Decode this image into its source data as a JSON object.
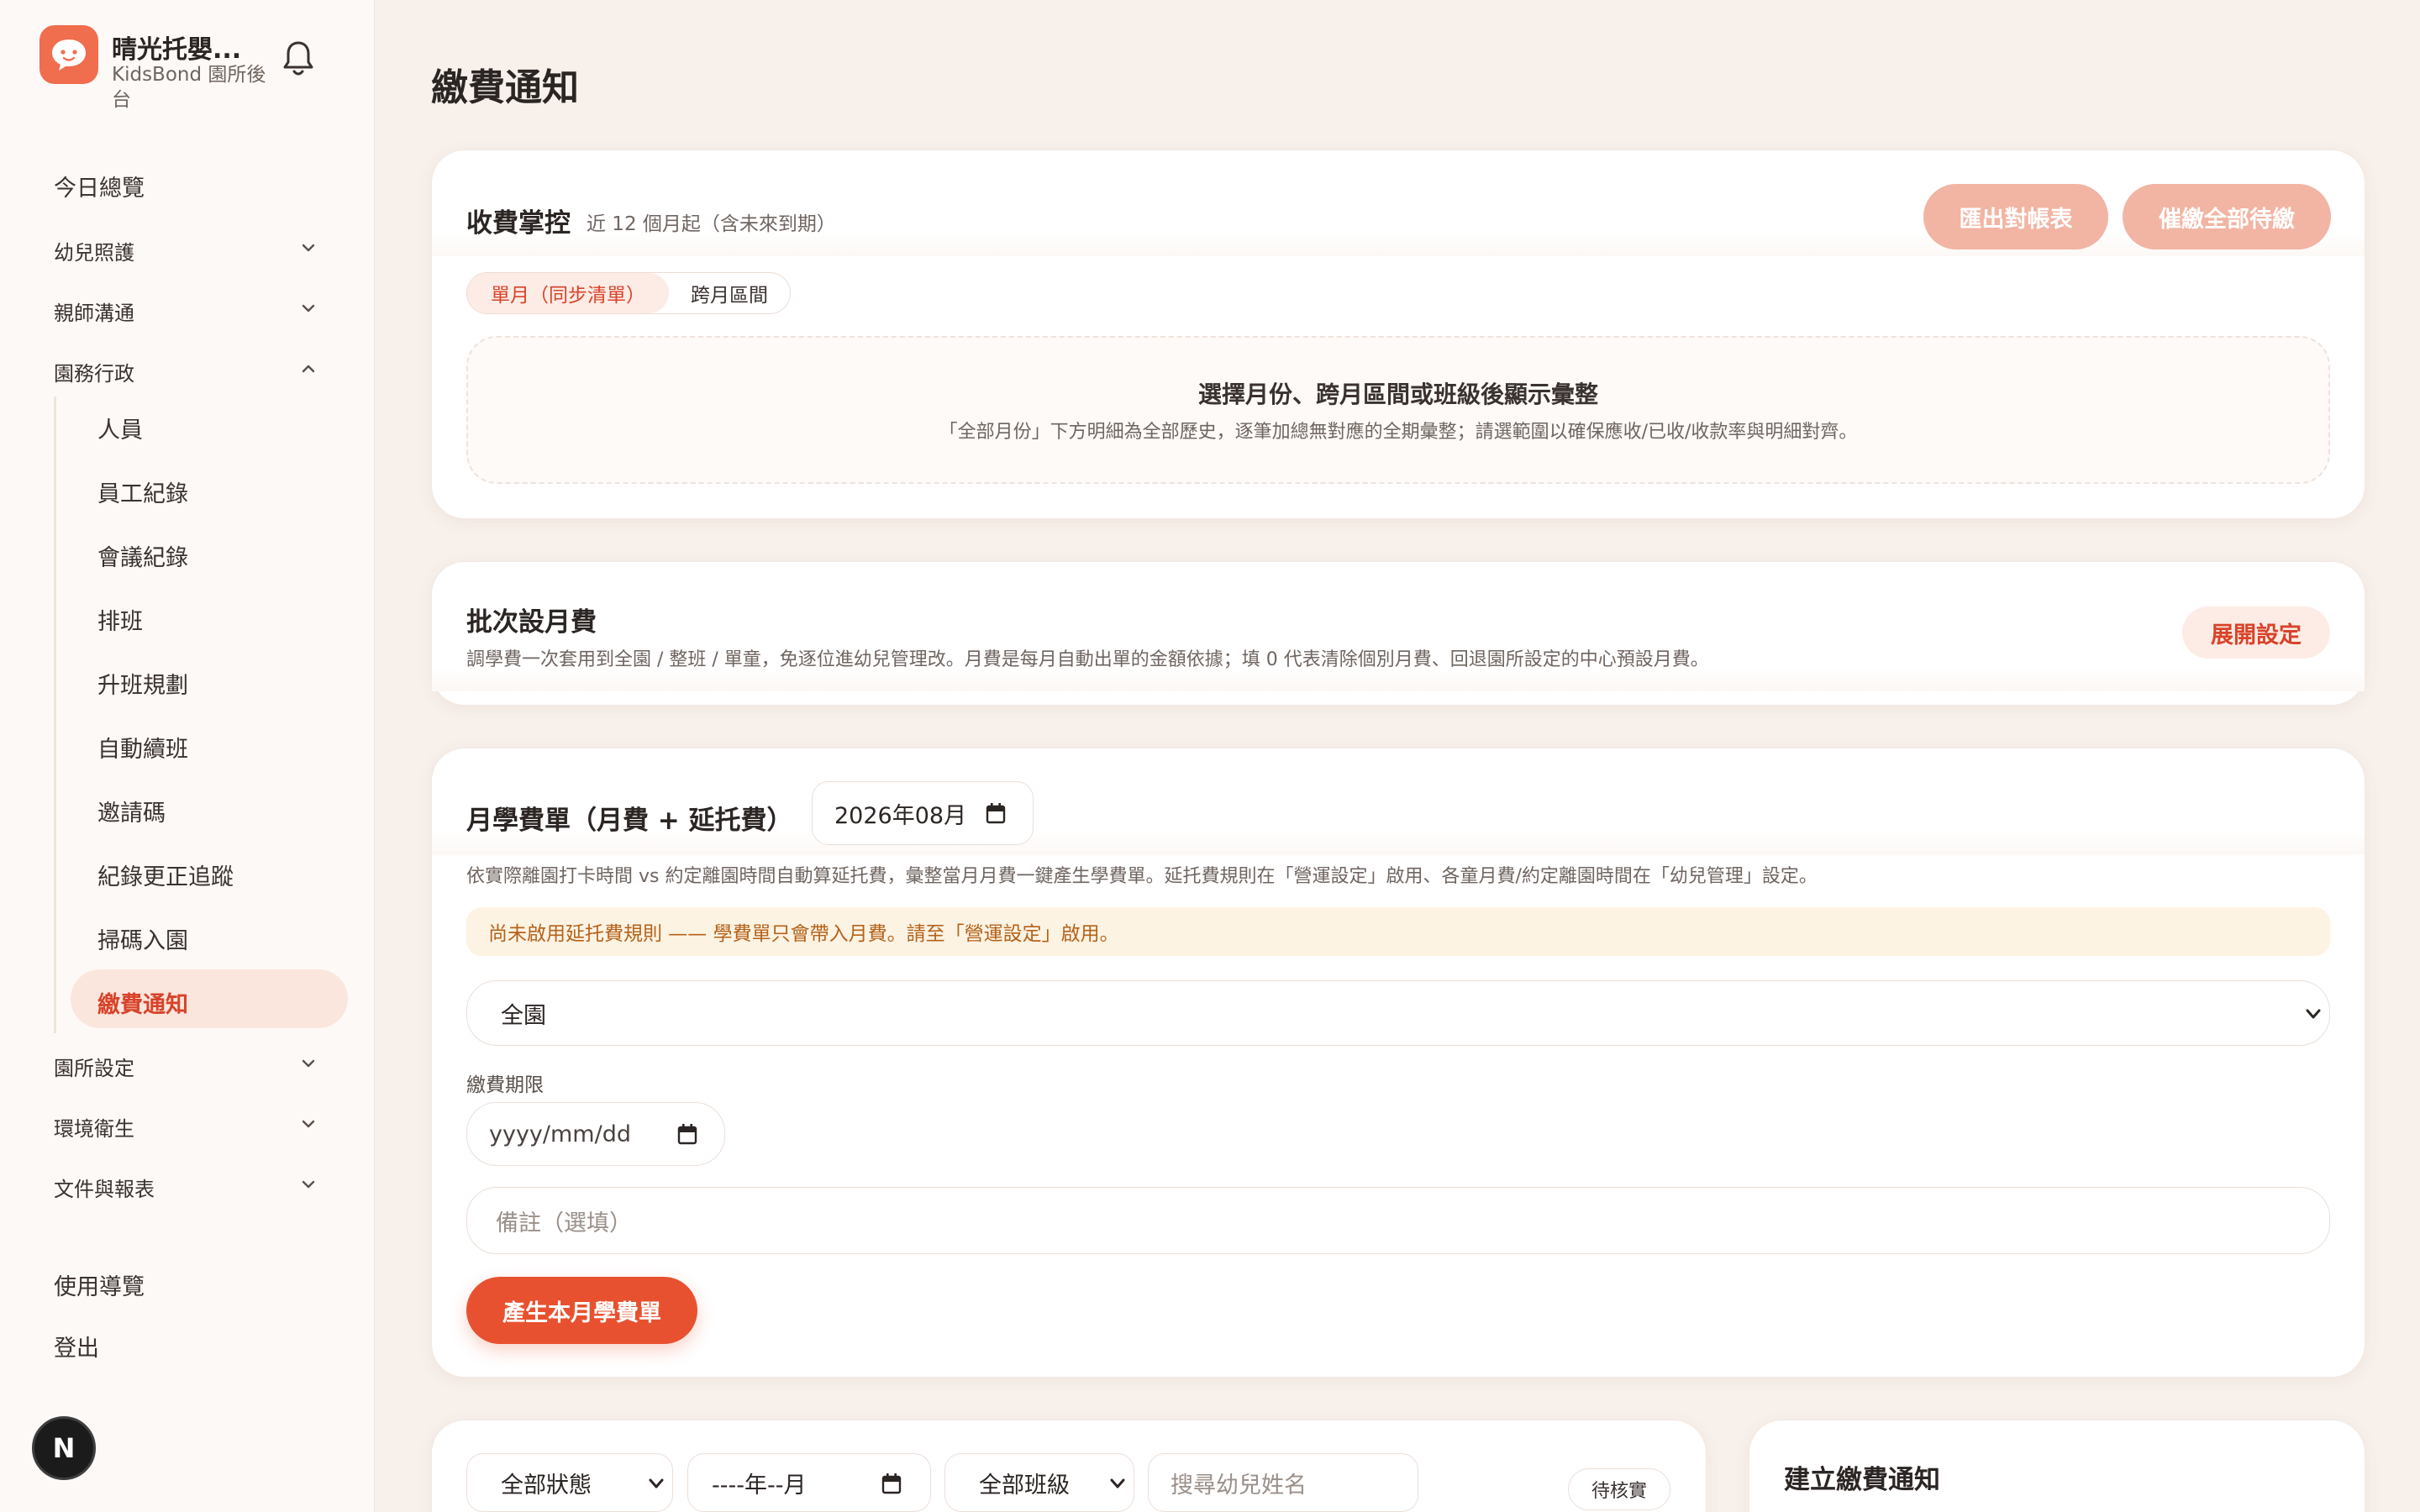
{
  "brand": {
    "name": "晴光托嬰...",
    "subtitle": "KidsBond 園所後台"
  },
  "sidebar": {
    "top_items": [
      {
        "label": "今日總覽"
      },
      {
        "label": "幼兒照護"
      },
      {
        "label": "親師溝通"
      },
      {
        "label": "園務行政"
      }
    ],
    "sub_items": [
      {
        "label": "人員"
      },
      {
        "label": "員工紀錄"
      },
      {
        "label": "會議紀錄"
      },
      {
        "label": "排班"
      },
      {
        "label": "升班規劃"
      },
      {
        "label": "自動續班"
      },
      {
        "label": "邀請碼"
      },
      {
        "label": "紀錄更正追蹤"
      },
      {
        "label": "掃碼入園"
      },
      {
        "label": "繳費通知"
      }
    ],
    "bottom_groups": [
      {
        "label": "園所設定"
      },
      {
        "label": "環境衛生"
      },
      {
        "label": "文件與報表"
      }
    ],
    "footer_items": [
      {
        "label": "使用導覽"
      },
      {
        "label": "登出"
      }
    ],
    "avatar_letter": "N"
  },
  "page": {
    "title": "繳費通知"
  },
  "billing_overview": {
    "title": "收費掌控",
    "subtitle": "近 12 個月起（含未來到期）",
    "export_label": "匯出對帳表",
    "remind_label": "催繳全部待繳",
    "seg_single": "單月（同步清單）",
    "seg_range": "跨月區間",
    "empty_title": "選擇月份、跨月區間或班級後顯示彙整",
    "empty_desc": "「全部月份」下方明細為全部歷史，逐筆加總無對應的全期彙整；請選範圍以確保應收/已收/收款率與明細對齊。"
  },
  "batch_fee": {
    "title": "批次設月費",
    "desc": "調學費一次套用到全園 / 整班 / 單童，免逐位進幼兒管理改。月費是每月自動出單的金額依據；填 0 代表清除個別月費、回退園所設定的中心預設月費。",
    "expand_label": "展開設定"
  },
  "monthly_bill": {
    "title": "月學費單（月費 + 延托費）",
    "month_value": "2026年08月",
    "desc": "依實際離園打卡時間 vs 約定離園時間自動算延托費，彙整當月月費一鍵產生學費單。延托費規則在「營運設定」啟用、各童月費/約定離園時間在「幼兒管理」設定。",
    "warning": "尚未啟用延托費規則 —— 學費單只會帶入月費。請至「營運設定」啟用。",
    "scope_value": "全園",
    "due_label": "繳費期限",
    "due_placeholder": "yyyy/mm/dd",
    "note_placeholder": "備註（選填）",
    "generate_label": "產生本月學費單"
  },
  "filters": {
    "status_value": "全部狀態",
    "month_placeholder": "----年--月",
    "class_value": "全部班級",
    "search_placeholder": "搜尋幼兒姓名",
    "pending_badge": "待核實"
  },
  "create_notice": {
    "title": "建立繳費通知"
  },
  "colors": {
    "accent": "#e8512f",
    "accent_soft": "#f2b4a3",
    "active_text": "#d8432a",
    "warning_bg": "#fdf3e3",
    "warning_text": "#b4621a",
    "background": "#f7f0eb"
  },
  "icons": [
    "chat-bubble-logo-icon",
    "bell-icon",
    "chevron-down-icon",
    "chevron-up-icon",
    "calendar-icon"
  ]
}
